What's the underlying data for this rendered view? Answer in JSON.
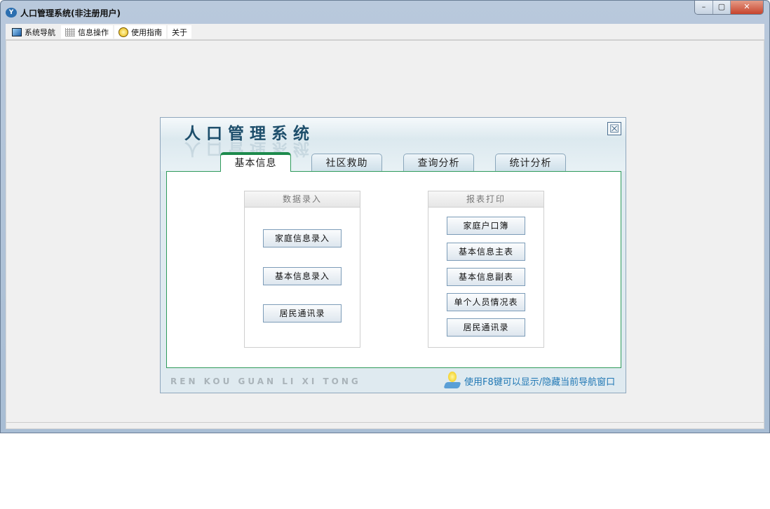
{
  "window": {
    "title": "人口管理系统(非注册用户)",
    "minimize": "–",
    "maximize": "▢",
    "close": "✕"
  },
  "menu": [
    {
      "label": "系统导航",
      "icon": "window-icon"
    },
    {
      "label": "信息操作",
      "icon": "grid-icon"
    },
    {
      "label": "使用指南",
      "icon": "help-icon"
    },
    {
      "label": "关于"
    }
  ],
  "panel": {
    "title": "人口管理系统",
    "close": "☒",
    "tabs": [
      {
        "label": "基本信息",
        "active": true
      },
      {
        "label": "社区救助"
      },
      {
        "label": "查询分析"
      },
      {
        "label": "统计分析"
      }
    ],
    "data_entry": {
      "title": "数据录入",
      "buttons": [
        "家庭信息录入",
        "基本信息录入",
        "居民通讯录"
      ]
    },
    "report_print": {
      "title": "报表打印",
      "buttons": [
        "家庭户口簿",
        "基本信息主表",
        "基本信息副表",
        "单个人员情况表",
        "居民通讯录"
      ]
    },
    "pinyin": "REN KOU GUAN LI XI TONG",
    "tip": "使用F8键可以显示/隐藏当前导航窗口"
  },
  "colors": {
    "accent_green": "#1d8a4c",
    "tip_blue": "#1f77b4"
  }
}
